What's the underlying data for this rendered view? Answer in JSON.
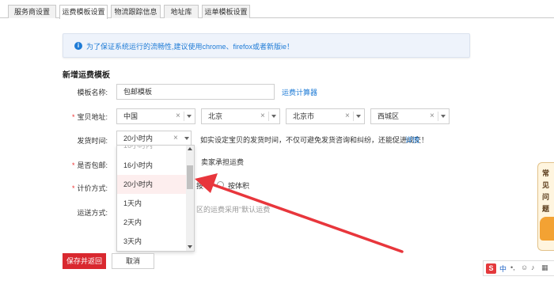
{
  "tabs": [
    {
      "label": "服务商设置"
    },
    {
      "label": "运费模板设置"
    },
    {
      "label": "物流跟踪信息"
    },
    {
      "label": "地址库"
    },
    {
      "label": "运单模板设置"
    }
  ],
  "notice": {
    "text": "为了保证系统运行的流畅性,建议使用chrome、firefox或者新版ie！"
  },
  "section_title": "新增运费模板",
  "form": {
    "template_name_label": "模板名称:",
    "template_name_value": "包邮模板",
    "calc_link": "运费计算器",
    "address_label": "宝贝地址:",
    "address": [
      "中国",
      "北京",
      "北京市",
      "西城区"
    ],
    "ship_time_label": "发货时间:",
    "ship_time_value": "20小时内",
    "ship_time_hint": "如实设定宝贝的发货时间，不仅可避免发货咨询和纠纷，还能促进成交！",
    "ship_time_link": "详情",
    "free_ship_label": "是否包邮:",
    "free_ship_option": "卖家承担运费",
    "pricing_label": "计价方式:",
    "pricing_option_partial": "按",
    "pricing_option_volume": "按体积",
    "delivery_label": "运送方式:",
    "delivery_hint": "区的运费采用\"默认运费"
  },
  "dropdown": {
    "partial_top": "16小时内",
    "options": [
      "16小时内",
      "20小时内",
      "1天内",
      "2天内",
      "3天内"
    ],
    "highlighted": "20小时内"
  },
  "buttons": {
    "save": "保存并返回",
    "cancel": "取消"
  },
  "side_help": {
    "chars": [
      "常",
      "见",
      "问",
      "题"
    ]
  },
  "ime": {
    "logo": "S",
    "mode": "中"
  },
  "colors": {
    "accent": "#1e7bd6",
    "primary": "#d9282f",
    "arrow": "#e8363c"
  }
}
